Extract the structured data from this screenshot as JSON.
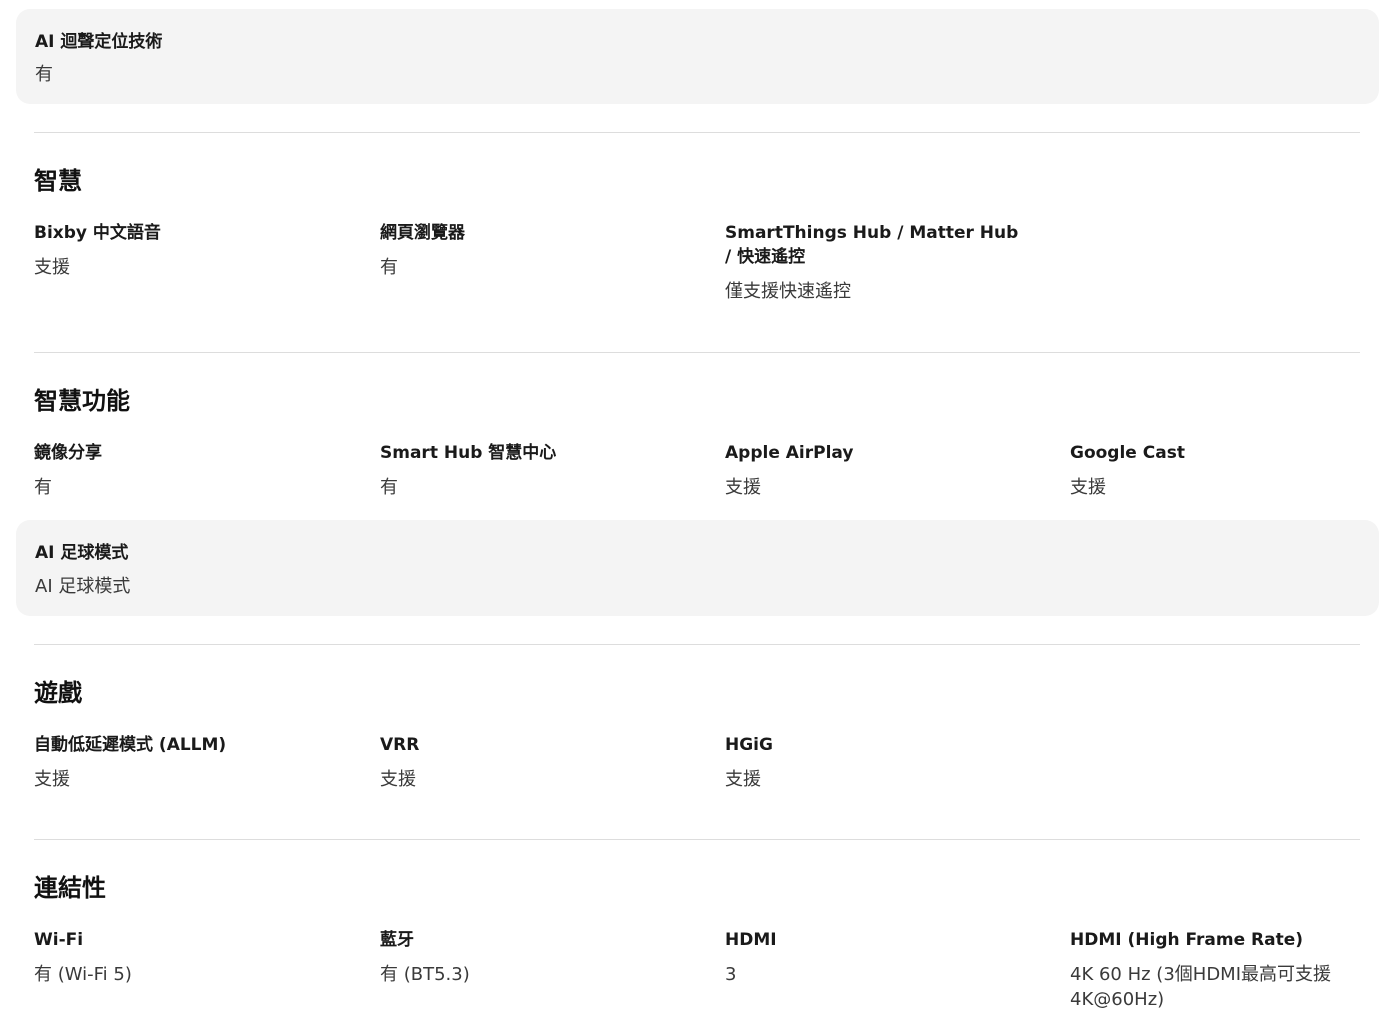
{
  "top_card": {
    "label": "AI 迴聲定位技術",
    "value": "有"
  },
  "smart": {
    "title": "智慧",
    "specs": [
      {
        "label": "Bixby 中文語音",
        "value": "支援"
      },
      {
        "label": "網頁瀏覽器",
        "value": "有"
      },
      {
        "label": "SmartThings Hub / Matter Hub / 快速遙控",
        "value": "僅支援快速遙控"
      }
    ]
  },
  "smart_features": {
    "title": "智慧功能",
    "specs": [
      {
        "label": "鏡像分享",
        "value": "有"
      },
      {
        "label": "Smart Hub 智慧中心",
        "value": "有"
      },
      {
        "label": "Apple AirPlay",
        "value": "支援"
      },
      {
        "label": "Google Cast",
        "value": "支援"
      }
    ]
  },
  "mid_card": {
    "label": "AI 足球模式",
    "value": "AI 足球模式"
  },
  "gaming": {
    "title": "遊戲",
    "specs": [
      {
        "label": "自動低延遲模式 (ALLM)",
        "value": "支援"
      },
      {
        "label": "VRR",
        "value": "支援"
      },
      {
        "label": "HGiG",
        "value": "支援"
      }
    ]
  },
  "connectivity": {
    "title": "連結性",
    "specs": [
      {
        "label": "Wi-Fi",
        "value": "有 (Wi-Fi 5)"
      },
      {
        "label": "藍牙",
        "value": "有 (BT5.3)"
      },
      {
        "label": "HDMI",
        "value": "3"
      },
      {
        "label": "HDMI (High Frame Rate)",
        "value": "4K 60 Hz (3個HDMI最高可支援 4K@60Hz)"
      }
    ]
  }
}
